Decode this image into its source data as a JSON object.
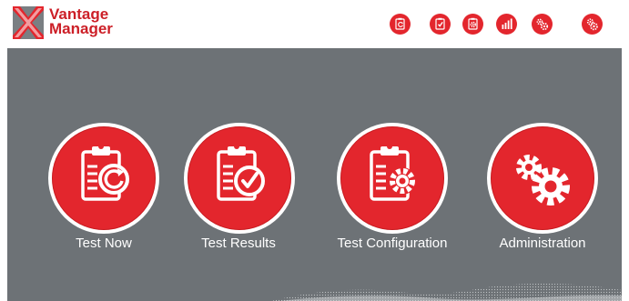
{
  "brand": {
    "line1": "Vantage",
    "line2": "Manager"
  },
  "colors": {
    "brand_red": "#e3262d",
    "panel_gray": "#6d7276",
    "text_white": "#ffffff"
  },
  "topnav": [
    {
      "icon": "test-now-icon"
    },
    {
      "icon": "test-results-icon"
    },
    {
      "icon": "test-configuration-icon"
    },
    {
      "icon": "bar-chart-icon"
    },
    {
      "icon": "gears-icon"
    },
    {
      "icon": "settings-gears-icon"
    }
  ],
  "tiles": [
    {
      "label": "Test Now",
      "icon": "clipboard-refresh-icon"
    },
    {
      "label": "Test Results",
      "icon": "clipboard-check-icon"
    },
    {
      "label": "Test Configuration",
      "icon": "clipboard-gear-icon"
    },
    {
      "label": "Administration",
      "icon": "gears-icon"
    }
  ]
}
